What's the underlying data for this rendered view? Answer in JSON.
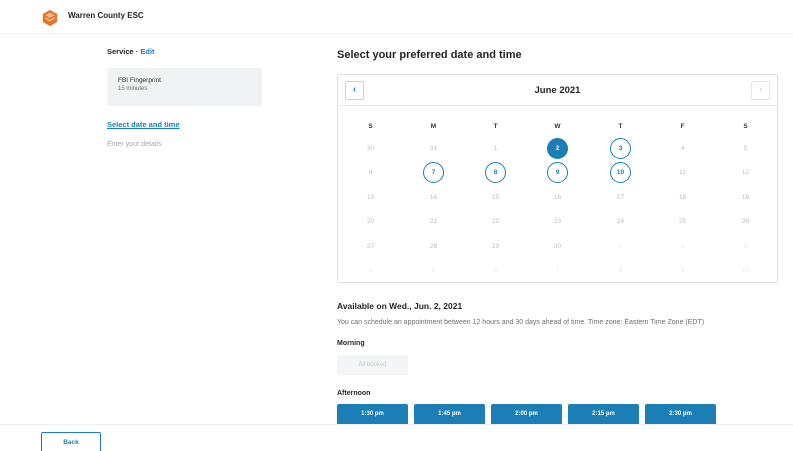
{
  "header": {
    "brand": "Warren County ESC",
    "logo_icon": "orange-hexagon-logo",
    "accent": "#e0772b"
  },
  "sidebar": {
    "service_label": "Service",
    "separator": " · ",
    "edit_label": "Edit",
    "service": {
      "name": "FBI Fingerprint",
      "duration": "15 minutes"
    },
    "steps": {
      "active": "Select date and time",
      "next": "Enter your details"
    }
  },
  "main": {
    "title": "Select your preferred date and time",
    "calendar": {
      "month": "June 2021",
      "prev_icon": "‹",
      "next_icon": "›",
      "weekdays": [
        "S",
        "M",
        "T",
        "W",
        "T",
        "F",
        "S"
      ],
      "weeks": [
        [
          {
            "d": "30",
            "s": "past"
          },
          {
            "d": "31",
            "s": "past"
          },
          {
            "d": "1",
            "s": "past"
          },
          {
            "d": "2",
            "s": "sel"
          },
          {
            "d": "3",
            "s": "avail"
          },
          {
            "d": "4",
            "s": "past"
          },
          {
            "d": "5",
            "s": "past"
          }
        ],
        [
          {
            "d": "6",
            "s": "past"
          },
          {
            "d": "7",
            "s": "avail"
          },
          {
            "d": "8",
            "s": "avail"
          },
          {
            "d": "9",
            "s": "avail"
          },
          {
            "d": "10",
            "s": "avail"
          },
          {
            "d": "11",
            "s": "past"
          },
          {
            "d": "12",
            "s": "past"
          }
        ],
        [
          {
            "d": "13",
            "s": "past"
          },
          {
            "d": "14",
            "s": "past"
          },
          {
            "d": "15",
            "s": "past"
          },
          {
            "d": "16",
            "s": "past"
          },
          {
            "d": "17",
            "s": "past"
          },
          {
            "d": "18",
            "s": "past"
          },
          {
            "d": "19",
            "s": "past"
          }
        ],
        [
          {
            "d": "20",
            "s": "past"
          },
          {
            "d": "21",
            "s": "past"
          },
          {
            "d": "22",
            "s": "past"
          },
          {
            "d": "23",
            "s": "past"
          },
          {
            "d": "24",
            "s": "past"
          },
          {
            "d": "25",
            "s": "past"
          },
          {
            "d": "26",
            "s": "past"
          }
        ],
        [
          {
            "d": "27",
            "s": "past"
          },
          {
            "d": "28",
            "s": "past"
          },
          {
            "d": "29",
            "s": "past"
          },
          {
            "d": "30",
            "s": "past"
          },
          {
            "d": "1",
            "s": "out"
          },
          {
            "d": "2",
            "s": "out"
          },
          {
            "d": "3",
            "s": "out"
          }
        ],
        [
          {
            "d": "4",
            "s": "out"
          },
          {
            "d": "5",
            "s": "out"
          },
          {
            "d": "6",
            "s": "out"
          },
          {
            "d": "7",
            "s": "out"
          },
          {
            "d": "8",
            "s": "out"
          },
          {
            "d": "9",
            "s": "out"
          },
          {
            "d": "10",
            "s": "out"
          }
        ]
      ]
    },
    "availability": {
      "title": "Available on Wed., Jun. 2, 2021",
      "note": "You can schedule an appointment between 12 hours and 30 days ahead of time. Time zone: Eastern Time Zone (EDT)",
      "morning_label": "Morning",
      "morning_status": "All booked",
      "afternoon_label": "Afternoon",
      "afternoon_slots": [
        "1:30 pm",
        "1:45 pm",
        "2:00 pm",
        "2:15 pm",
        "2:30 pm"
      ]
    }
  },
  "footer": {
    "back_label": "Back"
  },
  "colors": {
    "primary": "#1b7fb5",
    "muted": "#b9bcbf"
  }
}
